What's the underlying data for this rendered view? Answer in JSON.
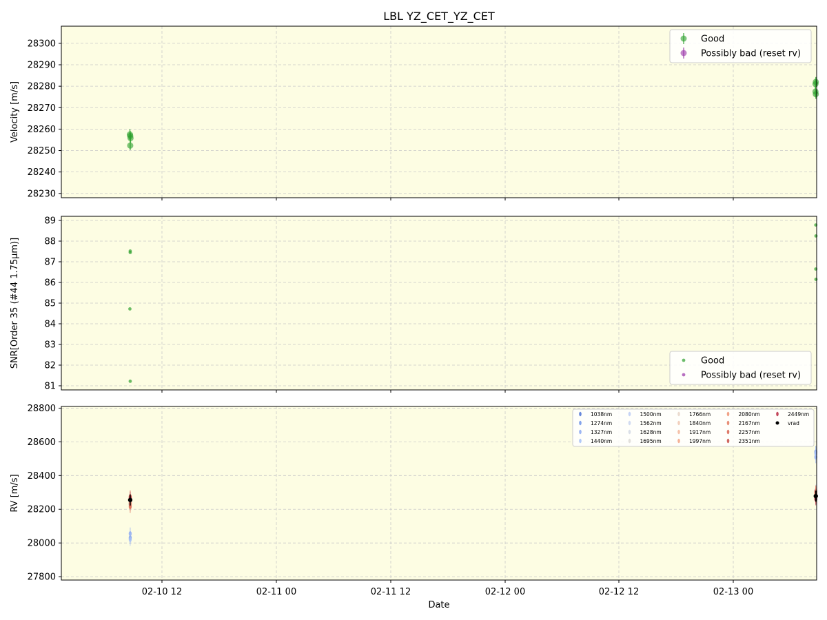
{
  "title": "LBL YZ_CET_YZ_CET",
  "xlabel": "Date",
  "x_ticks": [
    "02-10 12",
    "02-11 00",
    "02-11 12",
    "02-12 00",
    "02-12 12",
    "02-13 00"
  ],
  "colors": {
    "background": "#fdfde3",
    "good": "#2ca02c",
    "bad": "#9932a8",
    "vrad": "#000000",
    "grid": "#c8c8c8"
  },
  "chart_data": [
    {
      "type": "scatter",
      "ylabel": "Velocity [m/s]",
      "ylim": [
        28228,
        28308
      ],
      "yticks": [
        28230,
        28240,
        28250,
        28260,
        28270,
        28280,
        28290,
        28300
      ],
      "grid": true,
      "legend_position": "upper right",
      "legend": [
        "Good",
        "Possibly bad (reset rv)"
      ],
      "series": [
        {
          "name": "Good",
          "points": [
            {
              "x": "2023-02-10 08:38",
              "y": 28257.5,
              "err": 2.5
            },
            {
              "x": "2023-02-10 08:40",
              "y": 28256.8,
              "err": 2.3
            },
            {
              "x": "2023-02-10 08:42",
              "y": 28255.8,
              "err": 2.2
            },
            {
              "x": "2023-02-10 08:40",
              "y": 28252.3,
              "err": 2.1
            },
            {
              "x": "2023-02-13 08:38",
              "y": 28281.0,
              "err": 2.5
            },
            {
              "x": "2023-02-13 08:40",
              "y": 28282.0,
              "err": 2.3
            },
            {
              "x": "2023-02-13 08:38",
              "y": 28277.5,
              "err": 2.3
            },
            {
              "x": "2023-02-13 08:40",
              "y": 28276.3,
              "err": 2.2
            }
          ]
        },
        {
          "name": "Possibly bad (reset rv)",
          "points": []
        }
      ]
    },
    {
      "type": "scatter",
      "ylabel": "SNR[Order 35 (#44 1.75μm)]",
      "ylim": [
        80.8,
        89.2
      ],
      "yticks": [
        81,
        82,
        83,
        84,
        85,
        86,
        87,
        88,
        89
      ],
      "grid": true,
      "legend_position": "lower right",
      "legend": [
        "Good",
        "Possibly bad (reset rv)"
      ],
      "series": [
        {
          "name": "Good",
          "points": [
            {
              "x": "2023-02-10 08:40",
              "y": 87.52
            },
            {
              "x": "2023-02-10 08:40",
              "y": 87.45
            },
            {
              "x": "2023-02-10 08:38",
              "y": 84.72
            },
            {
              "x": "2023-02-10 08:40",
              "y": 81.22
            },
            {
              "x": "2023-02-13 08:40",
              "y": 88.78
            },
            {
              "x": "2023-02-13 08:41",
              "y": 88.25
            },
            {
              "x": "2023-02-13 08:40",
              "y": 86.65
            },
            {
              "x": "2023-02-13 08:41",
              "y": 86.15
            }
          ]
        },
        {
          "name": "Possibly bad (reset rv)",
          "points": []
        }
      ]
    },
    {
      "type": "scatter",
      "ylabel": "RV [m/s]",
      "ylim": [
        27780,
        28810
      ],
      "yticks": [
        27800,
        28000,
        28200,
        28400,
        28600,
        28800
      ],
      "grid": true,
      "legend_position": "upper right",
      "legend_columns": 5,
      "series": [
        {
          "name": "1038nm",
          "color": "#4e73d6",
          "points": [
            {
              "x": "2023-02-10 08:40",
              "y": 28230
            },
            {
              "x": "2023-02-13 08:40",
              "y": 28265
            }
          ]
        },
        {
          "name": "1274nm",
          "color": "#6f94e8",
          "points": [
            {
              "x": "2023-02-10 08:40",
              "y": 28030
            },
            {
              "x": "2023-02-13 08:40",
              "y": 28540
            }
          ]
        },
        {
          "name": "1327nm",
          "color": "#8ca9f2",
          "points": [
            {
              "x": "2023-02-10 08:40",
              "y": 28055
            },
            {
              "x": "2023-02-13 08:40",
              "y": 28510
            }
          ]
        },
        {
          "name": "1440nm",
          "color": "#a5bff7",
          "points": [
            {
              "x": "2023-02-10 08:40",
              "y": 28020
            },
            {
              "x": "2023-02-13 08:40",
              "y": 28530
            }
          ]
        },
        {
          "name": "1500nm",
          "color": "#bccdf5",
          "points": [
            {
              "x": "2023-02-10 08:40",
              "y": 28250
            },
            {
              "x": "2023-02-13 08:40",
              "y": 28310
            }
          ]
        },
        {
          "name": "1562nm",
          "color": "#c9d5ee",
          "points": [
            {
              "x": "2023-02-10 08:40",
              "y": 28265
            },
            {
              "x": "2023-02-13 08:40",
              "y": 28290
            }
          ]
        },
        {
          "name": "1628nm",
          "color": "#d4d9e4",
          "points": [
            {
              "x": "2023-02-10 08:40",
              "y": 28245
            },
            {
              "x": "2023-02-13 08:40",
              "y": 28270
            }
          ]
        },
        {
          "name": "1695nm",
          "color": "#dddbd6",
          "points": [
            {
              "x": "2023-02-10 08:40",
              "y": 28255
            },
            {
              "x": "2023-02-13 08:40",
              "y": 28285
            }
          ]
        },
        {
          "name": "1766nm",
          "color": "#e8d6c8",
          "points": [
            {
              "x": "2023-02-10 08:40",
              "y": 28260
            },
            {
              "x": "2023-02-13 08:40",
              "y": 28275
            }
          ]
        },
        {
          "name": "1840nm",
          "color": "#f0c8b2",
          "points": [
            {
              "x": "2023-02-10 08:40",
              "y": 28240
            },
            {
              "x": "2023-02-13 08:40",
              "y": 28295
            }
          ]
        },
        {
          "name": "1917nm",
          "color": "#f3b89c",
          "points": [
            {
              "x": "2023-02-10 08:40",
              "y": 28270
            },
            {
              "x": "2023-02-13 08:40",
              "y": 28280
            }
          ]
        },
        {
          "name": "1997nm",
          "color": "#f3a586",
          "points": [
            {
              "x": "2023-02-10 08:40",
              "y": 28225
            },
            {
              "x": "2023-02-13 08:40",
              "y": 28300
            }
          ]
        },
        {
          "name": "2080nm",
          "color": "#ee9272",
          "points": [
            {
              "x": "2023-02-10 08:40",
              "y": 28262
            },
            {
              "x": "2023-02-13 08:40",
              "y": 28268
            }
          ]
        },
        {
          "name": "2167nm",
          "color": "#e47b60",
          "points": [
            {
              "x": "2023-02-10 08:40",
              "y": 28235
            },
            {
              "x": "2023-02-13 08:40",
              "y": 28290
            }
          ]
        },
        {
          "name": "2257nm",
          "color": "#d86450",
          "points": [
            {
              "x": "2023-02-10 08:40",
              "y": 28215
            },
            {
              "x": "2023-02-13 08:40",
              "y": 28305
            }
          ]
        },
        {
          "name": "2351nm",
          "color": "#c84c44",
          "points": [
            {
              "x": "2023-02-10 08:40",
              "y": 28275
            },
            {
              "x": "2023-02-13 08:40",
              "y": 28275
            }
          ]
        },
        {
          "name": "2449nm",
          "color": "#b8283f",
          "points": [
            {
              "x": "2023-02-10 08:40",
              "y": 28265
            },
            {
              "x": "2023-02-13 08:40",
              "y": 28260
            }
          ]
        },
        {
          "name": "vrad",
          "color": "#000000",
          "points": [
            {
              "x": "2023-02-10 08:40",
              "y": 28255
            },
            {
              "x": "2023-02-13 08:40",
              "y": 28278
            }
          ]
        }
      ]
    }
  ]
}
